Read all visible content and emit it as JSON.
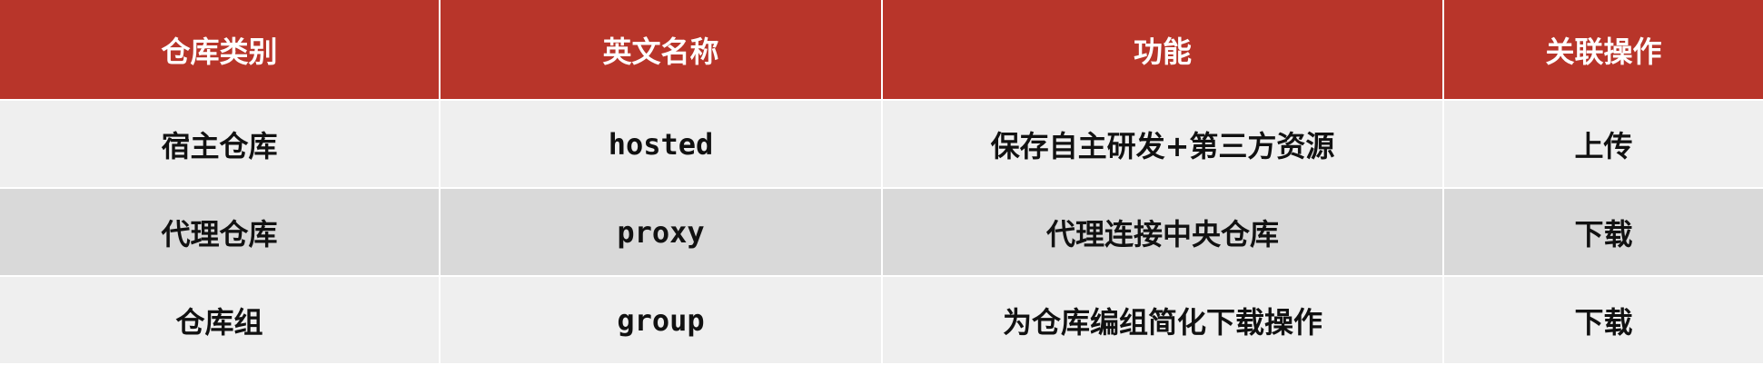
{
  "table": {
    "headers": [
      "仓库类别",
      "英文名称",
      "功能",
      "关联操作"
    ],
    "rows": [
      [
        "宿主仓库",
        "hosted",
        "保存自主研发+第三方资源",
        "上传"
      ],
      [
        "代理仓库",
        "proxy",
        "代理连接中央仓库",
        "下载"
      ],
      [
        "仓库组",
        "group",
        "为仓库编组简化下载操作",
        "下载"
      ]
    ]
  },
  "colors": {
    "header_bg": "#b8352a",
    "header_text": "#ffffff",
    "row_light": "#efefef",
    "row_dark": "#d9d9d9",
    "body_text": "#111111"
  }
}
